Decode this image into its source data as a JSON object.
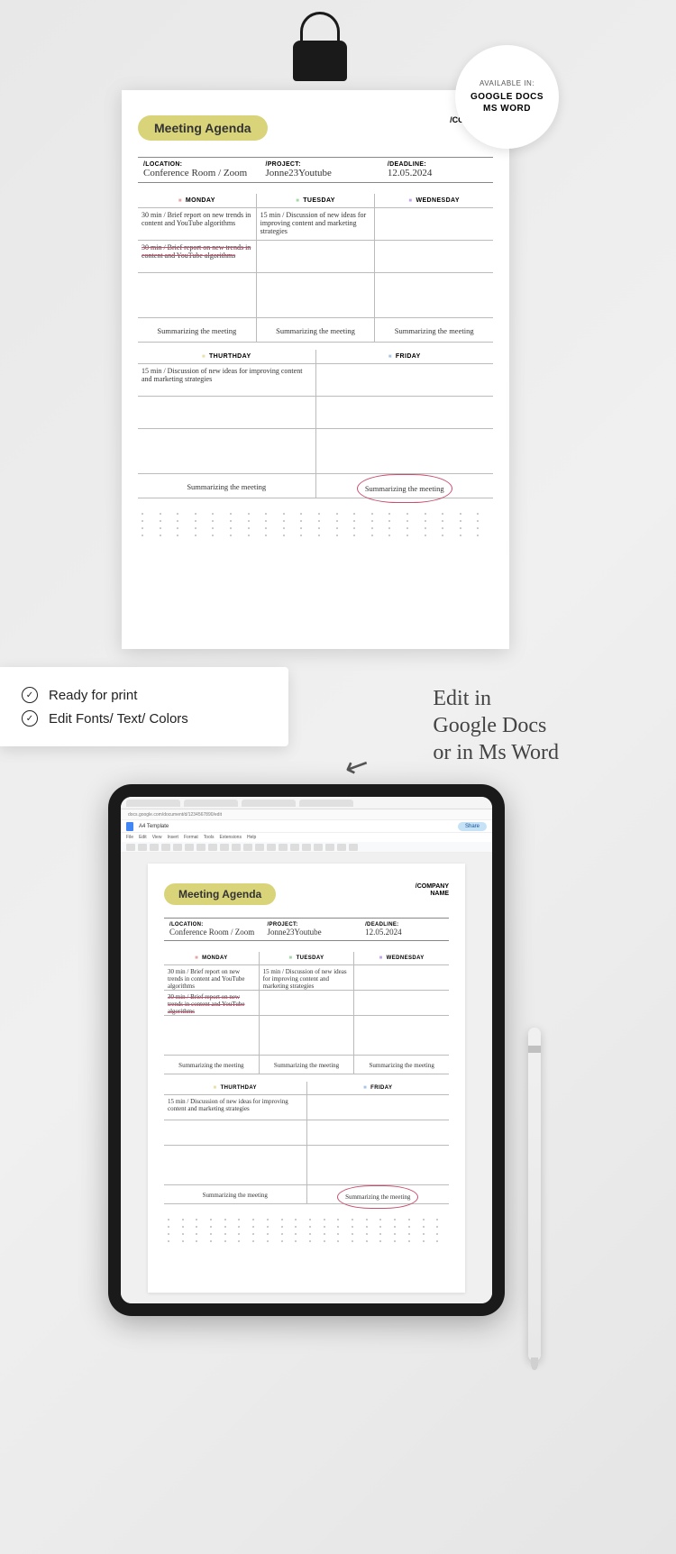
{
  "badge": {
    "avail": "AVAILABLE IN:",
    "apps": "GOOGLE DOCS\nMS WORD"
  },
  "agenda": {
    "title": "Meeting Agenda",
    "company": "/COMPANY\nNAME",
    "meta": {
      "loc_label": "/LOCATION:",
      "loc_val": "Conference Room / Zoom",
      "proj_label": "/PROJECT:",
      "proj_val": "Jonne23Youtube",
      "dead_label": "/DEADLINE:",
      "dead_val": "12.05.2024"
    },
    "days1": [
      "MONDAY",
      "TUESDAY",
      "WEDNESDAY"
    ],
    "days2": [
      "THURTHDAY",
      "FRIDAY"
    ],
    "mon": {
      "r1": "30 min / Brief report on new trends in content and YouTube algorithms",
      "r2": "30 min / Brief report on new trends in content and YouTube algorithms"
    },
    "tue": {
      "r1": "15 min / Discussion of new ideas for improving content and marketing strategies"
    },
    "thu": {
      "r1": "15 min / Discussion of new ideas for improving content and marketing strategies"
    },
    "summary": "Summarizing the meeting"
  },
  "features": {
    "f1": "Ready for print",
    "f2": "Edit Fonts/ Text/ Colors"
  },
  "handwrite": "Edit in\nGoogle Docs\nor in Ms Word",
  "docs": {
    "url": "docs.google.com/document/d/1234567890/edit",
    "title": "A4 Template",
    "menu": [
      "File",
      "Edit",
      "View",
      "Insert",
      "Format",
      "Tools",
      "Extensions",
      "Help"
    ],
    "share": "Share"
  }
}
